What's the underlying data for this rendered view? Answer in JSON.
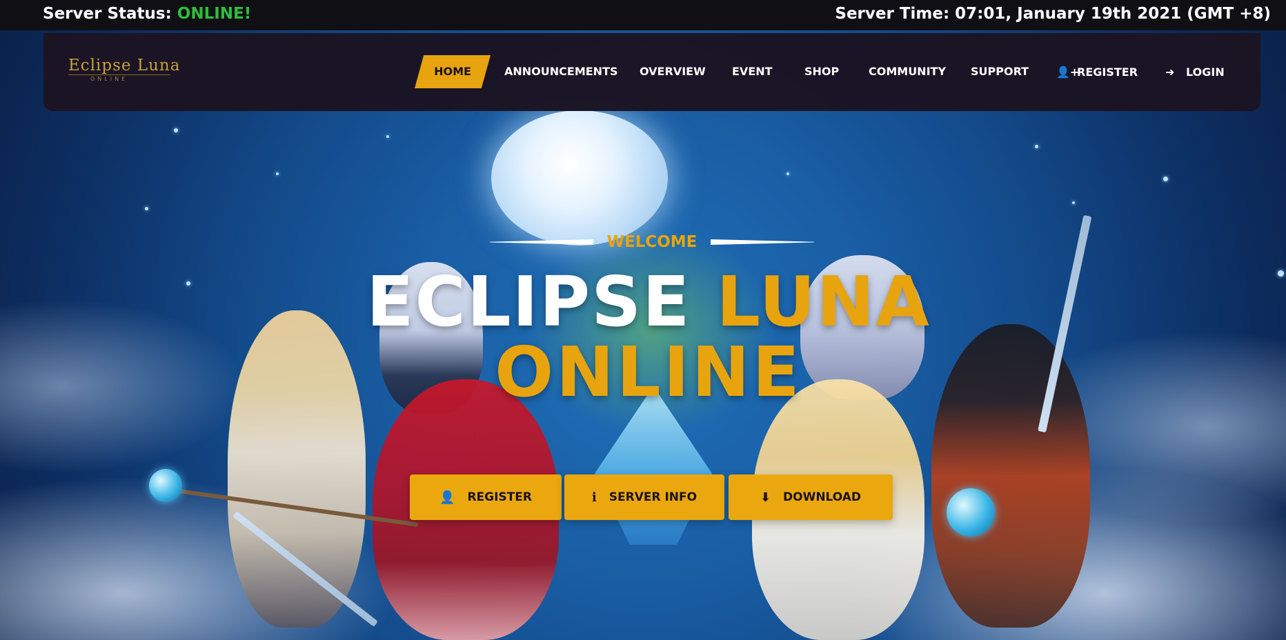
{
  "status_bar": {
    "status_label": "Server Status: ",
    "status_value": "ONLINE!",
    "server_time": "Server Time: 07:01, January 19th 2021 (GMT +8)"
  },
  "logo": {
    "title": "Eclipse Luna",
    "subtitle": "ONLINE"
  },
  "nav": {
    "home": "HOME",
    "announcements": "ANNOUNCEMENTS",
    "overview": "OVERVIEW",
    "event": "EVENT",
    "shop": "SHOP",
    "community": "COMMUNITY",
    "support": "SUPPORT",
    "register": "REGISTER",
    "login": "LOGIN"
  },
  "hero": {
    "welcome": "WELCOME",
    "title_white": "ECLIPSE ",
    "title_gold": "LUNA",
    "title_line2": "ONLINE",
    "buttons": {
      "register": "REGISTER",
      "server_info": "SERVER INFO",
      "download": "DOWNLOAD"
    }
  },
  "colors": {
    "accent": "#e8a40e",
    "online": "#2ebd3c",
    "navbar": "#1b1422",
    "status_bar": "#101014"
  },
  "icons": {
    "register": "user-plus-icon",
    "login": "sign-in-icon",
    "server_info": "info-icon",
    "download": "download-icon"
  }
}
